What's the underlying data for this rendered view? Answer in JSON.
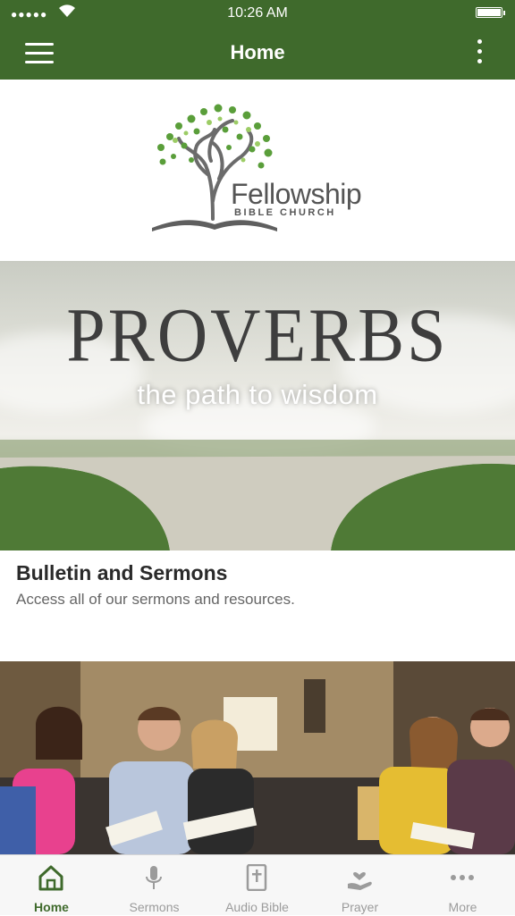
{
  "status_bar": {
    "time": "10:26 AM"
  },
  "header": {
    "title": "Home"
  },
  "logo": {
    "name": "Fellowship",
    "subtitle": "BIBLE CHURCH"
  },
  "banner": {
    "headline": "PROVERBS",
    "tagline": "the path to wisdom"
  },
  "card": {
    "title": "Bulletin and Sermons",
    "description": "Access all of our sermons and resources."
  },
  "tabs": [
    {
      "label": "Home",
      "icon": "home-icon",
      "active": true
    },
    {
      "label": "Sermons",
      "icon": "microphone-icon",
      "active": false
    },
    {
      "label": "Audio Bible",
      "icon": "bible-icon",
      "active": false
    },
    {
      "label": "Prayer",
      "icon": "prayer-hand-icon",
      "active": false
    },
    {
      "label": "More",
      "icon": "ellipsis-icon",
      "active": false
    }
  ],
  "colors": {
    "brand": "#3f6a2c",
    "tab_inactive": "#9b9b9b",
    "leaf_green": "#5a9e3a"
  }
}
